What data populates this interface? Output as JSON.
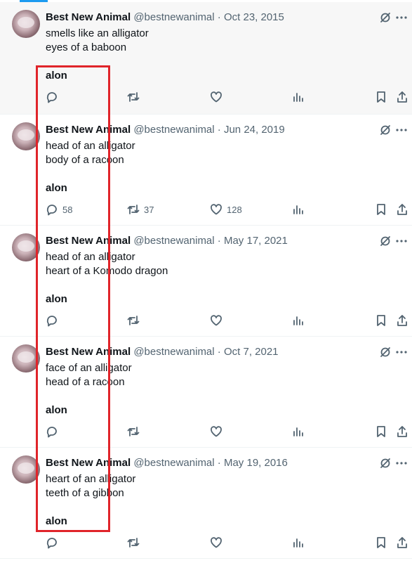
{
  "tweets": [
    {
      "name": "Best New Animal",
      "handle": "@bestnewanimal",
      "separator": "·",
      "date": "Oct 23, 2015",
      "lines": [
        "smells like an alligator",
        "eyes of a baboon"
      ],
      "author_tag": "alon",
      "counts": {
        "replies": "",
        "retweets": "",
        "likes": ""
      }
    },
    {
      "name": "Best New Animal",
      "handle": "@bestnewanimal",
      "separator": "·",
      "date": "Jun 24, 2019",
      "lines": [
        "head of an alligator",
        "body of a racoon"
      ],
      "author_tag": "alon",
      "counts": {
        "replies": "58",
        "retweets": "37",
        "likes": "128"
      }
    },
    {
      "name": "Best New Animal",
      "handle": "@bestnewanimal",
      "separator": "·",
      "date": "May 17, 2021",
      "lines": [
        "head of an alligator",
        "heart of a Komodo dragon"
      ],
      "author_tag": "alon",
      "counts": {
        "replies": "",
        "retweets": "",
        "likes": ""
      }
    },
    {
      "name": "Best New Animal",
      "handle": "@bestnewanimal",
      "separator": "·",
      "date": "Oct 7, 2021",
      "lines": [
        "face of an alligator",
        "head of a racoon"
      ],
      "author_tag": "alon",
      "counts": {
        "replies": "",
        "retweets": "",
        "likes": ""
      }
    },
    {
      "name": "Best New Animal",
      "handle": "@bestnewanimal",
      "separator": "·",
      "date": "May 19, 2016",
      "lines": [
        "heart of an alligator",
        "teeth of a gibbon"
      ],
      "author_tag": "alon",
      "counts": {
        "replies": "",
        "retweets": "",
        "likes": ""
      }
    }
  ],
  "icons": {
    "grok": "grok-icon",
    "more": "more-icon",
    "reply": "reply-icon",
    "retweet": "retweet-icon",
    "like": "like-icon",
    "views": "views-icon",
    "bookmark": "bookmark-icon",
    "share": "share-icon"
  },
  "colors": {
    "text_primary": "#0f1419",
    "text_secondary": "#536471",
    "highlight_box": "#e0242a",
    "accent": "#1d9bf0",
    "divider": "#eff3f4"
  }
}
